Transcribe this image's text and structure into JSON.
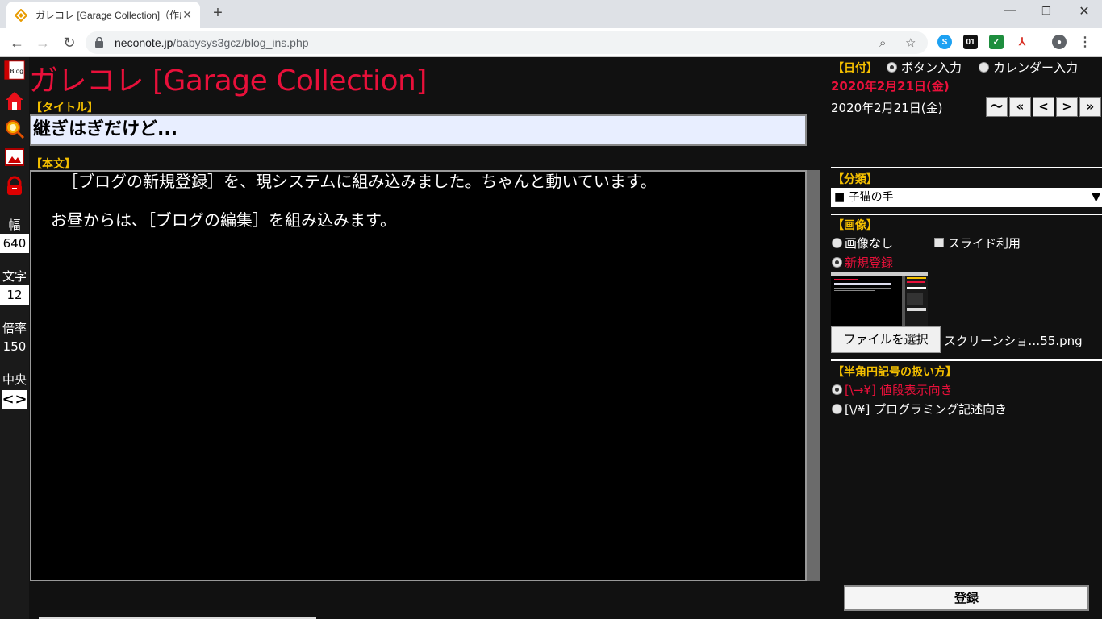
{
  "browser": {
    "tab_title": "ガレコレ [Garage Collection]（作成",
    "tab_close": "✕",
    "new_tab": "+",
    "url_host": "neconote.jp",
    "url_path": "/babysys3gcz/blog_ins.php",
    "ext_s": "S",
    "ext_01": "01"
  },
  "leftbar": {
    "width_label": "幅",
    "width_value": "640",
    "font_label": "文字",
    "font_value": "12",
    "zoom_label": "倍率",
    "zoom_value": "150",
    "center_label": "中央",
    "left_arrow": "<",
    "right_arrow": ">"
  },
  "main": {
    "site_title": "ガレコレ [Garage Collection]",
    "title_label": "【タイトル】",
    "title_value": "継ぎはぎだけど...",
    "body_label": "【本文】",
    "body_lines": [
      "［ブログの新規登録］を、現システムに組み込みました。ちゃんと動いています。",
      "お昼からは、［ブログの編集］を組み込みます。"
    ]
  },
  "right": {
    "date_label": "【日付】",
    "date_mode_button": "ボタン入力",
    "date_mode_calendar": "カレンダー入力",
    "date_selected": "2020年2月21日(金)",
    "date_display": "2020年2月21日(金)",
    "date_buttons": [
      "〜",
      "«",
      "<",
      ">",
      "»"
    ],
    "category_label": "【分類】",
    "category_value": "■ 子猫の手",
    "category_arrow": "▼",
    "image_label": "【画像】",
    "image_none": "画像なし",
    "image_slide": "スライド利用",
    "image_new": "新規登録",
    "file_button": "ファイルを選択",
    "file_name": "スクリーンショ…55.png",
    "yen_label": "【半角円記号の扱い方】",
    "yen_price": "[\\→¥] 値段表示向き",
    "yen_prog": "[\\/¥] プログラミング記述向き",
    "submit": "登録"
  }
}
